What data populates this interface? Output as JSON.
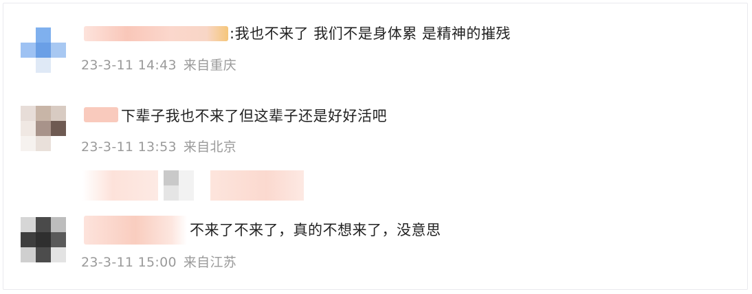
{
  "comments": [
    {
      "text": ":我也不来了 我们不是身体累 是精神的摧残",
      "time": "23-3-11 14:43",
      "location": "来自重庆"
    },
    {
      "text": "下辈子我也不来了但这辈子还是好好活吧",
      "time": "23-3-11 13:53",
      "location": "来自北京"
    },
    {
      "text": "不来了不来了，真的不想来了，没意思",
      "time": "23-3-11 15:00",
      "location": "来自江苏"
    }
  ],
  "colors": {
    "text": "#222222",
    "meta": "#9a9a9a",
    "name_blur": "#f7c9bd"
  }
}
